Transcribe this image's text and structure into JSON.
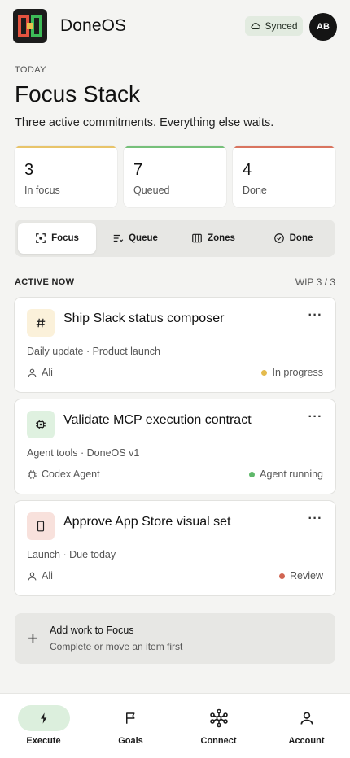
{
  "header": {
    "app_name": "DoneOS",
    "synced_label": "Synced",
    "avatar_initials": "AB"
  },
  "page": {
    "eyebrow": "TODAY",
    "title": "Focus Stack",
    "subtitle": "Three active commitments. Everything else waits."
  },
  "stats": [
    {
      "value": "3",
      "label": "In focus",
      "color": "#e8c46a"
    },
    {
      "value": "7",
      "label": "Queued",
      "color": "#76c07a"
    },
    {
      "value": "4",
      "label": "Done",
      "color": "#d9745f"
    }
  ],
  "tabs": [
    {
      "label": "Focus",
      "icon": "focus-icon",
      "active": true
    },
    {
      "label": "Queue",
      "icon": "queue-icon",
      "active": false
    },
    {
      "label": "Zones",
      "icon": "zones-icon",
      "active": false
    },
    {
      "label": "Done",
      "icon": "check-circle-icon",
      "active": false
    }
  ],
  "section": {
    "label": "ACTIVE NOW",
    "wip": "WIP 3 / 3"
  },
  "cards": [
    {
      "title": "Ship Slack status composer",
      "icon": "hash-icon",
      "icon_bg": "#fbf1da",
      "meta": "Daily update · Product launch",
      "owner": "Ali",
      "owner_icon": "user-icon",
      "status": "In progress",
      "status_color": "#e4bb4e"
    },
    {
      "title": "Validate MCP execution contract",
      "icon": "chip-icon",
      "icon_bg": "#dff1e0",
      "meta": "Agent tools · DoneOS v1",
      "owner": "Codex Agent",
      "owner_icon": "chip-icon",
      "status": "Agent running",
      "status_color": "#5fb86a"
    },
    {
      "title": "Approve App Store visual set",
      "icon": "phone-icon",
      "icon_bg": "#f8e1dc",
      "meta": "Launch · Due today",
      "owner": "Ali",
      "owner_icon": "user-icon",
      "status": "Review",
      "status_color": "#d16552"
    }
  ],
  "add_work": {
    "title": "Add work to Focus",
    "subtitle": "Complete or move an item first"
  },
  "bottom_nav": [
    {
      "label": "Execute",
      "icon": "bolt-icon",
      "active": true
    },
    {
      "label": "Goals",
      "icon": "flag-icon",
      "active": false
    },
    {
      "label": "Connect",
      "icon": "network-icon",
      "active": false
    },
    {
      "label": "Account",
      "icon": "user-icon",
      "active": false
    }
  ]
}
